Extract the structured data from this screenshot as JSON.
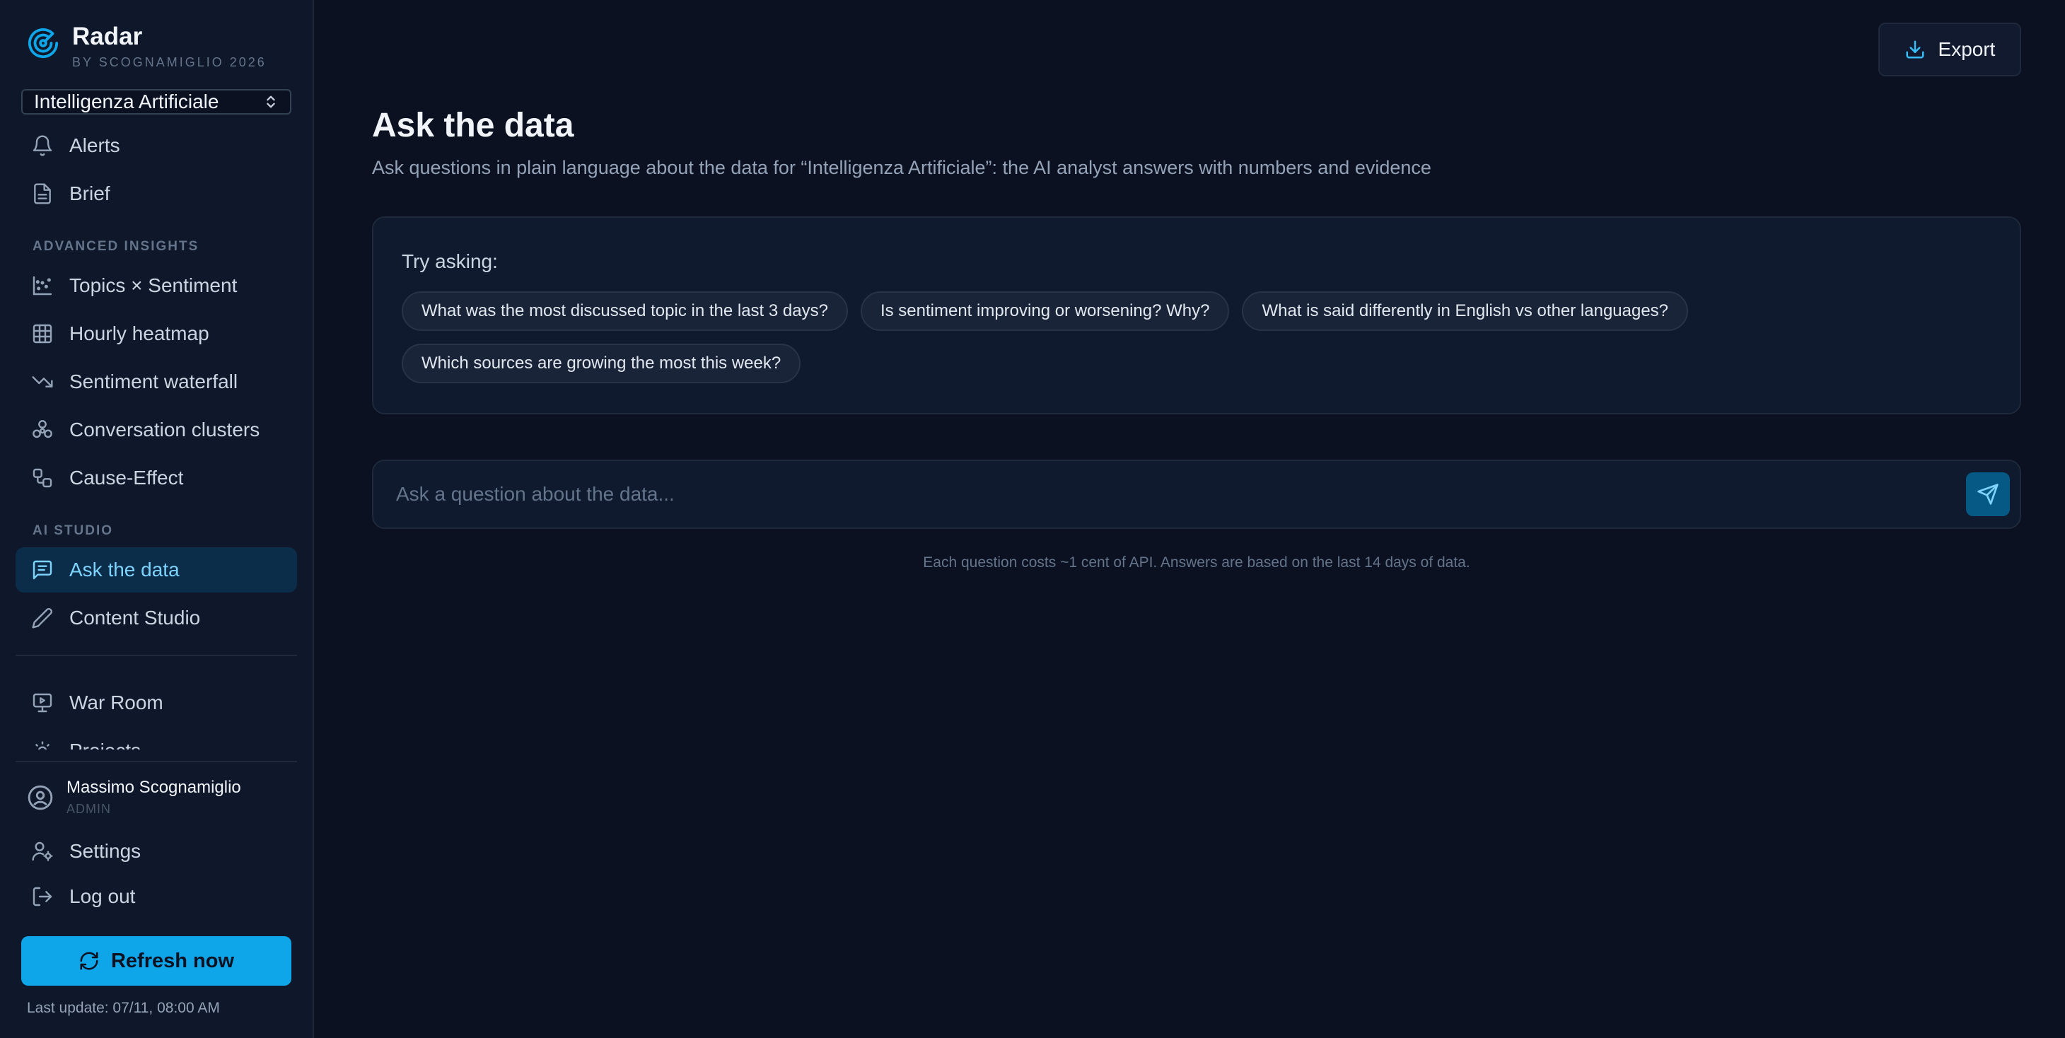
{
  "brand": {
    "name": "Radar",
    "subtitle": "BY SCOGNAMIGLIO 2026"
  },
  "project_select": {
    "value": "Intelligenza Artificiale"
  },
  "nav": {
    "alerts": "Alerts",
    "brief": "Brief",
    "section_advanced": "ADVANCED INSIGHTS",
    "topics_sentiment": "Topics × Sentiment",
    "hourly_heatmap": "Hourly heatmap",
    "sentiment_waterfall": "Sentiment waterfall",
    "conversation_clusters": "Conversation clusters",
    "cause_effect": "Cause-Effect",
    "section_ai": "AI STUDIO",
    "ask_the_data": "Ask the data",
    "content_studio": "Content Studio",
    "war_room": "War Room",
    "projects": "Projects"
  },
  "user": {
    "name": "Massimo Scognamiglio",
    "role": "ADMIN"
  },
  "account": {
    "settings": "Settings",
    "logout": "Log out"
  },
  "refresh": {
    "label": "Refresh now",
    "last_update": "Last update: 07/11, 08:00 AM"
  },
  "header": {
    "export_label": "Export"
  },
  "page": {
    "title": "Ask the data",
    "subtitle": "Ask questions in plain language about the data for “Intelligenza Artificiale”: the AI analyst answers with numbers and evidence"
  },
  "suggestions": {
    "label": "Try asking:",
    "items": [
      "What was the most discussed topic in the last 3 days?",
      "Is sentiment improving or worsening? Why?",
      "What is said differently in English vs other languages?",
      "Which sources are growing the most this week?"
    ]
  },
  "ask": {
    "placeholder": "Ask a question about the data...",
    "footnote": "Each question costs ~1 cent of API. Answers are based on the last 14 days of data."
  },
  "colors": {
    "accent": "#0ea5e9",
    "active_bg": "#0c2d4a",
    "background": "#0b1120"
  }
}
